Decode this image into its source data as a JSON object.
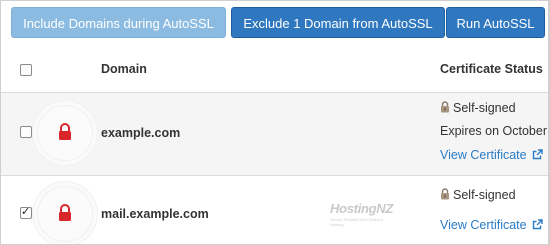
{
  "toolbar": {
    "include_label": "Include Domains during AutoSSL",
    "exclude_label": "Exclude 1 Domain from AutoSSL",
    "run_label": "Run AutoSSL"
  },
  "table": {
    "columns": {
      "domain": "Domain",
      "status": "Certificate Status"
    },
    "rows": [
      {
        "domain": "example.com",
        "checked": false,
        "status": "Self-signed",
        "expires": "Expires on October",
        "link": "View Certificate"
      },
      {
        "domain": "mail.example.com",
        "checked": true,
        "status": "Self-signed",
        "link": "View Certificate"
      }
    ]
  },
  "watermark": {
    "brand": "HostingNZ",
    "tagline": "Secure Reliable New Zealand Hosting"
  },
  "colors": {
    "button_light": "#8cbbe2",
    "button_dark": "#2f78c0",
    "lock_red": "#d9262b",
    "link_blue": "#2a7cc7"
  },
  "icons": {
    "domain_lock": "padlock-red-icon",
    "status_lock": "padlock-small-icon",
    "external_link": "external-link-icon"
  }
}
